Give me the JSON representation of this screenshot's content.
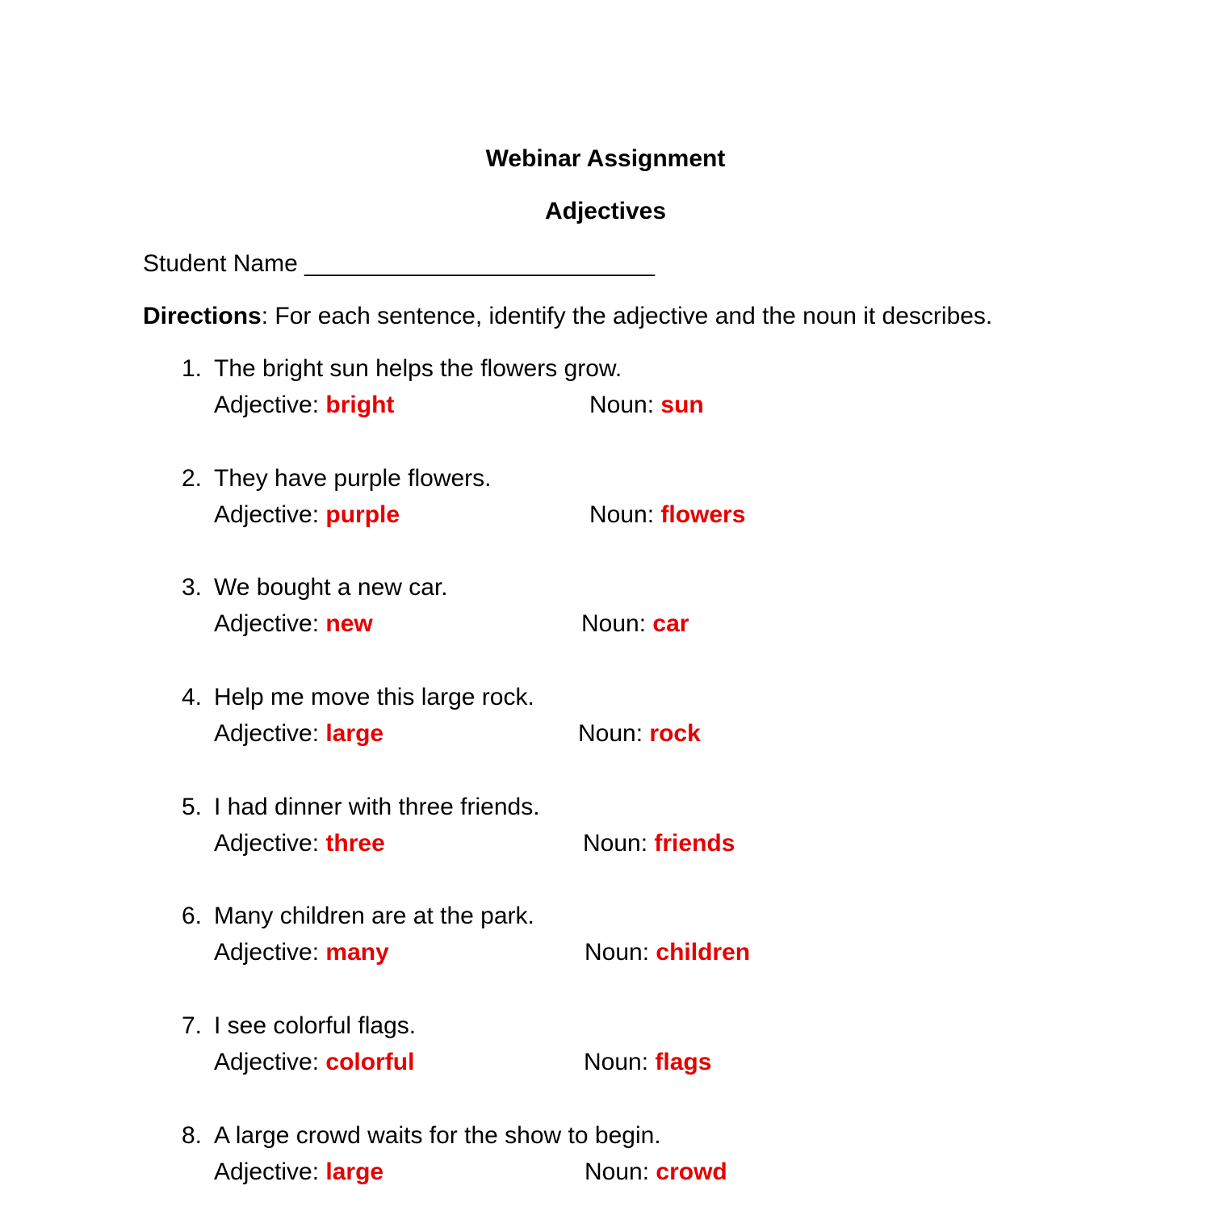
{
  "header": {
    "title": "Webinar Assignment",
    "subtitle": "Adjectives"
  },
  "student_name": {
    "label": "Student Name",
    "blank": "__________________________"
  },
  "directions": {
    "label": "Directions",
    "text": ": For each sentence, identify the adjective and the noun it describes."
  },
  "labels": {
    "adjective": "Adjective: ",
    "noun": "Noun: "
  },
  "answer_color": "#e60000",
  "items": [
    {
      "number": "1.",
      "sentence": "The bright sun helps the flowers grow.",
      "adjective": "bright",
      "noun": "sun"
    },
    {
      "number": "2.",
      "sentence": "They have purple flowers.",
      "adjective": "purple",
      "noun": "flowers"
    },
    {
      "number": "3.",
      "sentence": "We bought a new car.",
      "adjective": "new",
      "noun": "car"
    },
    {
      "number": "4.",
      "sentence": "Help me move this large rock.",
      "adjective": "large",
      "noun": "rock"
    },
    {
      "number": "5.",
      "sentence": "I had dinner with three friends.",
      "adjective": "three",
      "noun": "friends"
    },
    {
      "number": "6.",
      "sentence": "Many children are at the park.",
      "adjective": "many",
      "noun": "children"
    },
    {
      "number": "7.",
      "sentence": "I see colorful flags.",
      "adjective": "colorful",
      "noun": "flags"
    },
    {
      "number": "8.",
      "sentence": "A large crowd waits for the show to begin.",
      "adjective": "large",
      "noun": "crowd"
    }
  ]
}
